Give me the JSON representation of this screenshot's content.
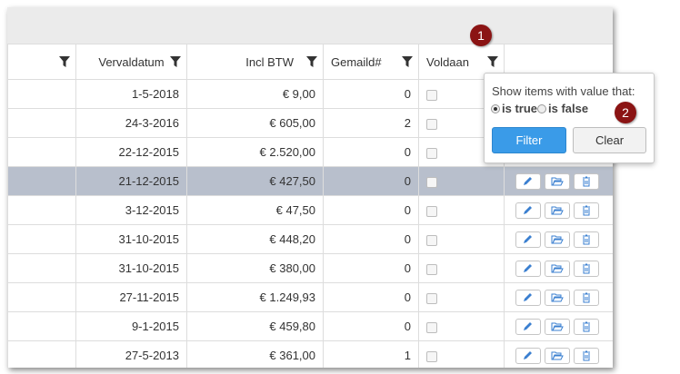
{
  "columns": [
    {
      "label": ""
    },
    {
      "label": "Vervaldatum"
    },
    {
      "label": "Incl BTW"
    },
    {
      "label": "Gemaild#"
    },
    {
      "label": "Voldaan"
    }
  ],
  "rows": [
    {
      "date": "1-5-2018",
      "amount": "€ 9,00",
      "mailed": "0"
    },
    {
      "date": "24-3-2016",
      "amount": "€ 605,00",
      "mailed": "2"
    },
    {
      "date": "22-12-2015",
      "amount": "€ 2.520,00",
      "mailed": "0"
    },
    {
      "date": "21-12-2015",
      "amount": "€ 427,50",
      "mailed": "0"
    },
    {
      "date": "3-12-2015",
      "amount": "€ 47,50",
      "mailed": "0"
    },
    {
      "date": "31-10-2015",
      "amount": "€ 448,20",
      "mailed": "0"
    },
    {
      "date": "31-10-2015",
      "amount": "€ 380,00",
      "mailed": "0"
    },
    {
      "date": "27-11-2015",
      "amount": "€ 1.249,93",
      "mailed": "0"
    },
    {
      "date": "9-1-2015",
      "amount": "€ 459,80",
      "mailed": "0"
    },
    {
      "date": "27-5-2013",
      "amount": "€ 361,00",
      "mailed": "1"
    }
  ],
  "filter_popup": {
    "message": "Show items with value that:",
    "option_true": "is true",
    "option_false": "is false",
    "selected": "true",
    "filter_label": "Filter",
    "clear_label": "Clear"
  },
  "badges": [
    "1",
    "2"
  ],
  "icons": {
    "column_filter": "funnel-icon",
    "edit": "pencil-icon",
    "open": "folder-open-icon",
    "delete": "trash-icon"
  },
  "colors": {
    "selected_row": "#b8bfcc",
    "primary_button": "#3a9be8",
    "badge": "#8b1414",
    "action_icon": "#3a7fd0"
  }
}
